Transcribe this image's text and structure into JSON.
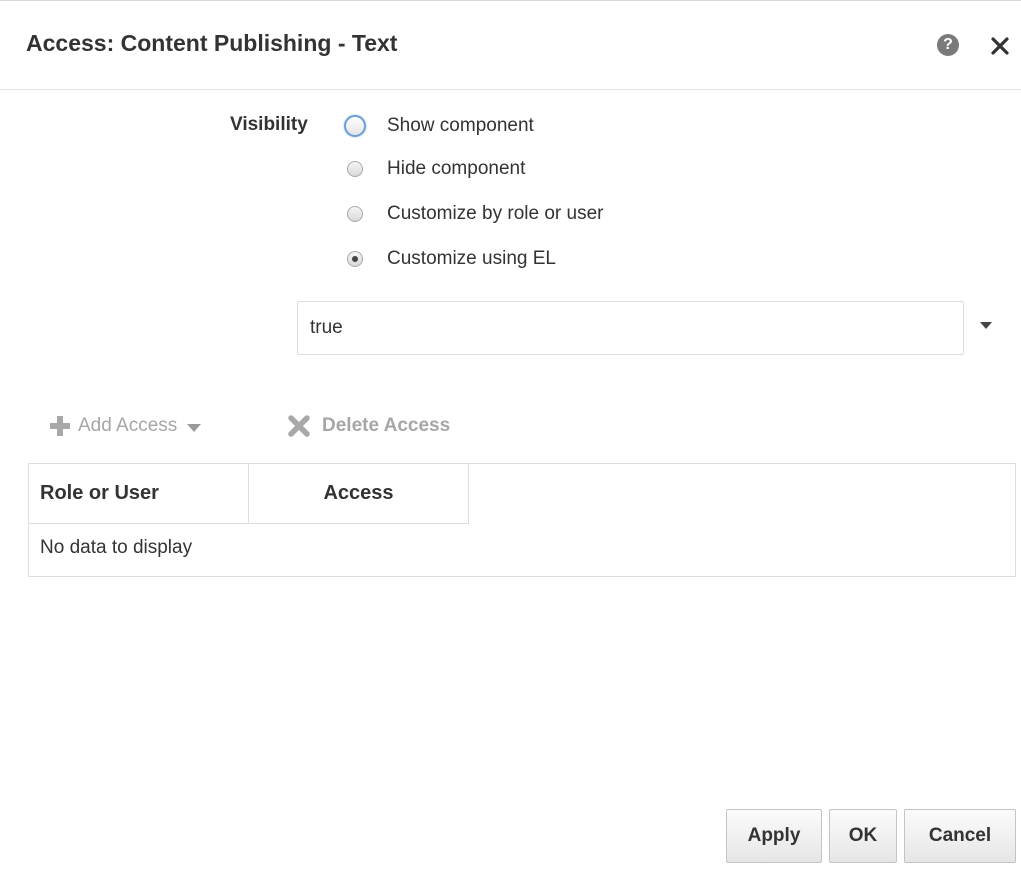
{
  "dialog": {
    "title": "Access: Content Publishing - Text",
    "help_icon": "question-circle",
    "help_glyph": "?",
    "close_icon": "close-x"
  },
  "visibility": {
    "label": "Visibility",
    "options": [
      {
        "label": "Show component",
        "checked": false,
        "focused": true
      },
      {
        "label": "Hide component",
        "checked": false,
        "focused": false
      },
      {
        "label": "Customize by role or user",
        "checked": false,
        "focused": false
      },
      {
        "label": "Customize using EL",
        "checked": true,
        "focused": false
      }
    ],
    "el_expression": "true"
  },
  "toolbar": {
    "add_access_label": "Add Access",
    "add_icon": "plus-icon",
    "delete_access_label": "Delete Access",
    "delete_icon": "x-icon",
    "disabled_color": "#a6a6a6"
  },
  "access_table": {
    "columns": [
      "Role or User",
      "Access"
    ],
    "rows": [],
    "empty_message": "No data to display"
  },
  "footer": {
    "apply_label": "Apply",
    "ok_label": "OK",
    "cancel_label": "Cancel"
  },
  "colors": {
    "title_text": "#333333",
    "border": "#dedede",
    "focus_ring": "#6c9ed8"
  }
}
